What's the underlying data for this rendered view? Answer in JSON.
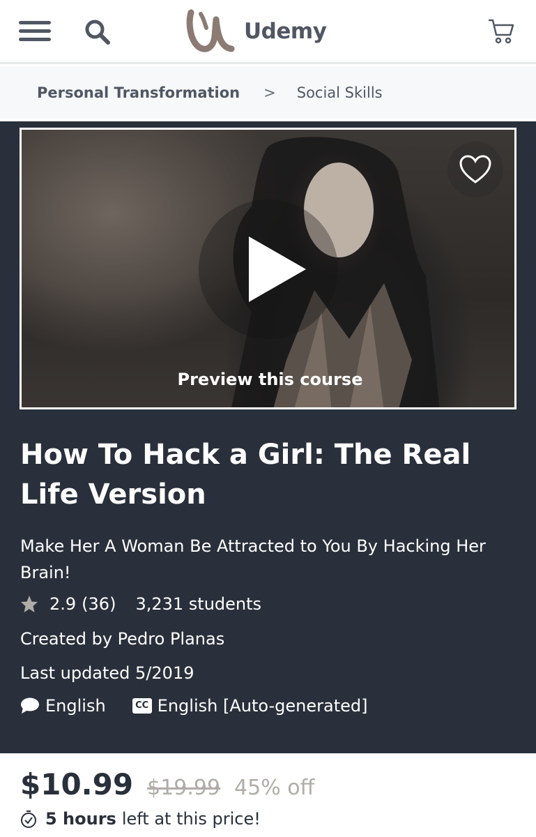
{
  "header": {
    "logo_text": "Udemy",
    "icons": [
      "menu-icon",
      "search-icon",
      "udemy-logo-mark",
      "cart-icon"
    ]
  },
  "breadcrumb": {
    "items": [
      "Personal Transformation",
      "Social Skills"
    ],
    "separator": ">"
  },
  "preview": {
    "label": "Preview this course",
    "icons": [
      "heart-icon",
      "play-icon"
    ]
  },
  "course": {
    "title": "How To Hack a Girl: The Real Life Version",
    "subtitle": "Make Her A Woman Be Attracted to You By Hacking Her Brain!",
    "rating": "2.9",
    "rating_count": "(36)",
    "students": "3,231 students",
    "created_by": "Created by Pedro Planas",
    "last_updated": "Last updated 5/2019",
    "language": "English",
    "captions_badge": "CC",
    "captions": "English [Auto-generated]"
  },
  "pricing": {
    "price": "$10.99",
    "original_price": "$19.99",
    "discount": "45% off",
    "timer_bold": "5 hours",
    "timer_rest": "left at this price!"
  },
  "colors": {
    "hero_bg": "#29303b",
    "text_dark": "#29303b",
    "muted": "#b0aca8",
    "logo_mark": "#8b7b72"
  }
}
